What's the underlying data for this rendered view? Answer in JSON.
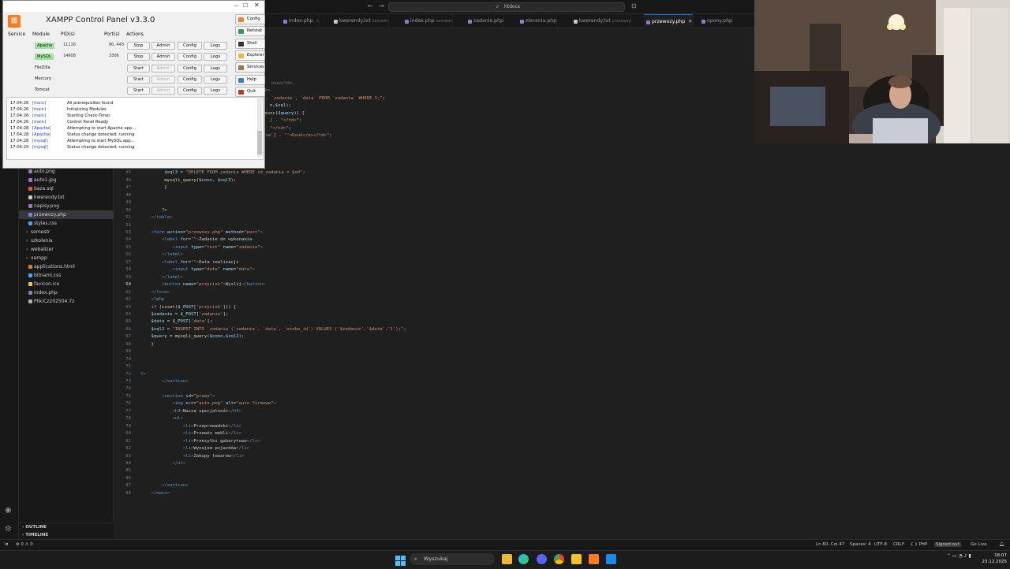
{
  "vscode": {
    "search": "htdocs",
    "tabs": [
      {
        "label": "index.php",
        "desc": "..\\",
        "type": "php"
      },
      {
        "label": "kwerendy.txt",
        "desc": "semestr",
        "type": "txt"
      },
      {
        "label": "index.php",
        "desc": "semestr",
        "type": "php"
      },
      {
        "label": "zadanie.php",
        "desc": "",
        "type": "php"
      },
      {
        "label": "zlecenia.php",
        "desc": "",
        "type": "php"
      },
      {
        "label": "kwerendy.txt",
        "desc": "przewozy",
        "type": "txt"
      },
      {
        "label": "przewozy.php",
        "desc": "",
        "type": "php",
        "active": true
      },
      {
        "label": "opony.php",
        "desc": "",
        "type": "php"
      }
    ],
    "files": [
      {
        "name": "auto.png",
        "icon": "image"
      },
      {
        "name": "auto1.jpg",
        "icon": "image"
      },
      {
        "name": "baza.sql",
        "icon": "sql"
      },
      {
        "name": "kwerendy.txt",
        "icon": "txt"
      },
      {
        "name": "napisy.png",
        "icon": "image"
      },
      {
        "name": "przewozy.php",
        "icon": "php",
        "selected": true
      },
      {
        "name": "styles.css",
        "icon": "css"
      },
      {
        "name": "semestr",
        "icon": "folder"
      },
      {
        "name": "szkolenia",
        "icon": "folder"
      },
      {
        "name": "webalizer",
        "icon": "folder"
      },
      {
        "name": "xampp",
        "icon": "folder"
      },
      {
        "name": "applications.html",
        "icon": "html"
      },
      {
        "name": "bitnami.css",
        "icon": "css"
      },
      {
        "name": "favicon.ico",
        "icon": "ico"
      },
      {
        "name": "index.php",
        "icon": "php"
      },
      {
        "name": "PlikiCz202504.7z",
        "icon": "archive"
      }
    ],
    "outline_label": "OUTLINE",
    "timeline_label": "TIMELINE",
    "status": {
      "problems": "⊗ 0 ⚠ 0",
      "position": "Ln 60, Col 47",
      "spaces": "Spaces: 4",
      "encoding": "UTF-8",
      "eol": "CRLF",
      "language": "{ } PHP",
      "account": "Signed out",
      "golive": "Go Live"
    }
  },
  "code_lines": [
    {
      "n": "",
      "html": "<span class=\"tg\">nia&lt;/th&gt;</span>"
    },
    {
      "n": "",
      "html": "<span class=\"tg\">h&gt;</span>"
    },
    {
      "n": "",
      "html": "e<span class=\"s\">`, `zadanie`, `data` FROM `zadania` WHERE 1;\"</span>;"
    },
    {
      "n": "",
      "html": "n,<span class=\"v\">$sql</span>);"
    },
    {
      "n": "",
      "html": "<span class=\"f\">assoc</span>(<span class=\"v\">$query</span>)) {"
    },
    {
      "n": "",
      "html": "<span class=\"s\">] . \"&lt;/td&gt;</span>\";"
    },
    {
      "n": "",
      "html": "<span class=\"s\">\"&lt;/td&gt;\"</span>;"
    },
    {
      "n": "40",
      "html": "        <span class=\"f\">echo</span> <span class=\"s\">\"&lt;td&gt;&lt;a href='?id=\"</span> . <span class=\"v\">$a</span>[<span class=\"s\">'id_zadania'</span>] . <span class=\"s\">\"'&gt;Usuń&lt;/a&gt;&lt;/td&gt;\"</span>;"
    },
    {
      "n": "41",
      "html": "        <span class=\"f\">echo</span> <span class=\"s\">\"&lt;/tr&gt;\"</span>;"
    },
    {
      "n": "42",
      "html": "        }"
    },
    {
      "n": "43",
      "html": "        <span class=\"c\">if</span> (<span class=\"f\">isset</span>(<span class=\"v\">$_GET</span>[<span class=\"s\">\"id\"</span>])) {"
    },
    {
      "n": "44",
      "html": "         <span class=\"v\">$id</span> = (<span class=\"k\">int</span>)<span class=\"v\">$_GET</span>[<span class=\"s\">'id'</span>];"
    },
    {
      "n": "45",
      "html": "         <span class=\"v\">$sql3</span> = <span class=\"s\">\"DELETE FROM zadania WHERE id_zadania = $id\"</span>;"
    },
    {
      "n": "46",
      "html": "         <span class=\"f\">mysqli_query</span>(<span class=\"v\">$conn</span>, <span class=\"v\">$sql3</span>);"
    },
    {
      "n": "47",
      "html": "         }"
    },
    {
      "n": "48",
      "html": ""
    },
    {
      "n": "49",
      "html": ""
    },
    {
      "n": "50",
      "html": "        ?&gt;"
    },
    {
      "n": "51",
      "html": "    <span class=\"tg\">&lt;/</span><span class=\"k\">table</span><span class=\"tg\">&gt;</span>"
    },
    {
      "n": "52",
      "html": ""
    },
    {
      "n": "53",
      "html": "    <span class=\"tg\">&lt;</span><span class=\"k\">form</span> <span class=\"a\">action</span>=<span class=\"s\">\"przewozy.php\"</span> <span class=\"a\">method</span>=<span class=\"s\">\"post\"</span><span class=\"tg\">&gt;</span>"
    },
    {
      "n": "54",
      "html": "        <span class=\"tg\">&lt;</span><span class=\"k\">label</span> <span class=\"a\">for</span>=<span class=\"s\">\"\"</span><span class=\"tg\">&gt;</span>Zadanie do wykonania"
    },
    {
      "n": "55",
      "html": "            <span class=\"tg\">&lt;</span><span class=\"k\">input</span> <span class=\"a\">type</span>=<span class=\"s\">\"text\"</span> <span class=\"a\">name</span>=<span class=\"s\">\"zadanie\"</span><span class=\"tg\">&gt;</span>"
    },
    {
      "n": "56",
      "html": "        <span class=\"tg\">&lt;/</span><span class=\"k\">label</span><span class=\"tg\">&gt;</span>"
    },
    {
      "n": "57",
      "html": "        <span class=\"tg\">&lt;</span><span class=\"k\">label</span> <span class=\"a\">for</span>=<span class=\"s\">\"\"</span><span class=\"tg\">&gt;</span>Data realizacji"
    },
    {
      "n": "58",
      "html": "            <span class=\"tg\">&lt;</span><span class=\"k\">input</span> <span class=\"a\">type</span>=<span class=\"s\">\"date\"</span> <span class=\"a\">name</span>=<span class=\"s\">\"data\"</span><span class=\"tg\">&gt;</span>"
    },
    {
      "n": "59",
      "html": "        <span class=\"tg\">&lt;/</span><span class=\"k\">label</span><span class=\"tg\">&gt;</span>"
    },
    {
      "n": "60",
      "html": "        <span class=\"tg\">&lt;</span><span class=\"k\">button</span> <span class=\"a\">name</span>=<span class=\"s\">\"przycisk\"</span><span class=\"tg\">&gt;</span>Wyslij<span class=\"tg\">&lt;/</span><span class=\"k\">button</span><span class=\"tg\">&gt;</span>",
      "current": true
    },
    {
      "n": "61",
      "html": "    <span class=\"tg\">&lt;/</span><span class=\"k\">form</span><span class=\"tg\">&gt;</span>"
    },
    {
      "n": "62",
      "html": "    <span class=\"k\">&lt;?php</span>"
    },
    {
      "n": "63",
      "html": "    <span class=\"c\">if</span> (<span class=\"f\">isset</span>(<span class=\"v\">$_POST</span>[<span class=\"s\">'przycisk'</span>])) {"
    },
    {
      "n": "64",
      "html": "    <span class=\"v\">$zadanie</span> = <span class=\"v\">$_POST</span>[<span class=\"s\">'zadanie'</span>];"
    },
    {
      "n": "65",
      "html": "    <span class=\"v\">$data</span> = <span class=\"v\">$_POST</span>[<span class=\"s\">'data'</span>];"
    },
    {
      "n": "66",
      "html": "    <span class=\"v\">$sql2</span> = <span class=\"s\">\"INSERT INTO `zadania`(`zadanie`, `data`, `osoba_id`) VALUES ('$zadanie','$data','1');\"</span>;"
    },
    {
      "n": "67",
      "html": "    <span class=\"v\">$query</span> = <span class=\"f\">mysqli_query</span>(<span class=\"v\">$conn</span>,<span class=\"v\">$sql2</span>);"
    },
    {
      "n": "68",
      "html": "    }"
    },
    {
      "n": "69",
      "html": ""
    },
    {
      "n": "70",
      "html": ""
    },
    {
      "n": "71",
      "html": ""
    },
    {
      "n": "72",
      "html": "<span class=\"k\">?&gt;</span>"
    },
    {
      "n": "73",
      "html": "        <span class=\"tg\">&lt;/</span><span class=\"k\">section</span><span class=\"tg\">&gt;</span>"
    },
    {
      "n": "74",
      "html": ""
    },
    {
      "n": "75",
      "html": "        <span class=\"tg\">&lt;</span><span class=\"k\">section</span> <span class=\"a\">id</span>=<span class=\"s\">\"prawy\"</span><span class=\"tg\">&gt;</span>"
    },
    {
      "n": "76",
      "html": "            <span class=\"tg\">&lt;</span><span class=\"k\">img</span> <span class=\"a\">src</span>=<span class=\"s\">\"auto.png\"</span> <span class=\"a\">alt</span>=<span class=\"s\">\"auto firmowe\"</span><span class=\"tg\">&gt;</span>"
    },
    {
      "n": "77",
      "html": "            <span class=\"tg\">&lt;</span><span class=\"k\">h3</span><span class=\"tg\">&gt;</span>Nasza specjalność<span class=\"tg\">&lt;/</span><span class=\"k\">h3</span><span class=\"tg\">&gt;</span>"
    },
    {
      "n": "78",
      "html": "            <span class=\"tg\">&lt;</span><span class=\"k\">ul</span><span class=\"tg\">&gt;</span>"
    },
    {
      "n": "79",
      "html": "                <span class=\"tg\">&lt;</span><span class=\"k\">li</span><span class=\"tg\">&gt;</span>Przeprowadzki<span class=\"tg\">&lt;/</span><span class=\"k\">li</span><span class=\"tg\">&gt;</span>"
    },
    {
      "n": "80",
      "html": "                <span class=\"tg\">&lt;</span><span class=\"k\">li</span><span class=\"tg\">&gt;</span>Przewóz mebli<span class=\"tg\">&lt;/</span><span class=\"k\">li</span><span class=\"tg\">&gt;</span>"
    },
    {
      "n": "81",
      "html": "                <span class=\"tg\">&lt;</span><span class=\"k\">li</span><span class=\"tg\">&gt;</span>Przesyłki gabarytowe<span class=\"tg\">&lt;/</span><span class=\"k\">li</span><span class=\"tg\">&gt;</span>"
    },
    {
      "n": "82",
      "html": "                <span class=\"tg\">&lt;</span><span class=\"k\">li</span><span class=\"tg\">&gt;</span>Wynajem pojazdów<span class=\"tg\">&lt;/</span><span class=\"k\">li</span><span class=\"tg\">&gt;</span>"
    },
    {
      "n": "83",
      "html": "                <span class=\"tg\">&lt;</span><span class=\"k\">li</span><span class=\"tg\">&gt;</span>Zakupy towarów<span class=\"tg\">&lt;/</span><span class=\"k\">li</span><span class=\"tg\">&gt;</span>"
    },
    {
      "n": "84",
      "html": "            <span class=\"tg\">&lt;/</span><span class=\"k\">ul</span><span class=\"tg\">&gt;</span>"
    },
    {
      "n": "85",
      "html": ""
    },
    {
      "n": "86",
      "html": ""
    },
    {
      "n": "87",
      "html": "        <span class=\"tg\">&lt;/</span><span class=\"k\">section</span><span class=\"tg\">&gt;</span>"
    },
    {
      "n": "88",
      "html": "    <span class=\"tg\">&lt;/</span><span class=\"k\">main</span><span class=\"tg\">&gt;</span>"
    }
  ],
  "xampp": {
    "title": "XAMPP Control Panel v3.3.0",
    "headers": {
      "service": "Service",
      "module": "Module",
      "pid": "PID(s)",
      "port": "Port(s)",
      "actions": "Actions"
    },
    "modules": [
      {
        "name": "Apache",
        "pid": "11116",
        "port": "80, 443",
        "state": "running",
        "action": "Stop",
        "admin_enabled": true
      },
      {
        "name": "MySQL",
        "pid": "14608",
        "port": "3306",
        "state": "running",
        "action": "Stop",
        "admin_enabled": true
      },
      {
        "name": "FileZilla",
        "pid": "",
        "port": "",
        "state": "stopped",
        "action": "Start",
        "admin_enabled": false
      },
      {
        "name": "Mercury",
        "pid": "",
        "port": "",
        "state": "stopped",
        "action": "Start",
        "admin_enabled": false
      },
      {
        "name": "Tomcat",
        "pid": "",
        "port": "",
        "state": "stopped",
        "action": "Start",
        "admin_enabled": false
      }
    ],
    "admin_label": "Admin",
    "config_label": "Config",
    "logs_label": "Logs",
    "side_buttons": [
      "Config",
      "Netstat",
      "Shell",
      "Explorer",
      "Services",
      "Help",
      "Quit"
    ],
    "log": [
      {
        "time": "17:04:26",
        "module": "[main]",
        "msg": "All prerequisites found"
      },
      {
        "time": "17:04:26",
        "module": "[main]",
        "msg": "Initializing Modules"
      },
      {
        "time": "17:04:26",
        "module": "[main]",
        "msg": "Starting Check-Timer"
      },
      {
        "time": "17:04:26",
        "module": "[main]",
        "msg": "Control Panel Ready"
      },
      {
        "time": "17:04:28",
        "module": "[Apache]",
        "msg": "Attempting to start Apache app..."
      },
      {
        "time": "17:04:28",
        "module": "[Apache]",
        "msg": "Status change detected: running"
      },
      {
        "time": "17:04:28",
        "module": "[mysql]",
        "msg": "Attempting to start MySQL app..."
      },
      {
        "time": "17:04:29",
        "module": "[mysql]",
        "msg": "Status change detected: running"
      }
    ]
  },
  "taskbar": {
    "search": "Wyszukaj",
    "time": "18:07",
    "date": "23.12.2025"
  },
  "colors": {
    "editor_bg": "#1f1f1f",
    "xampp_accent": "#fb7a24",
    "running": "#9fe39f",
    "active_tab_border": "#0078d4"
  }
}
